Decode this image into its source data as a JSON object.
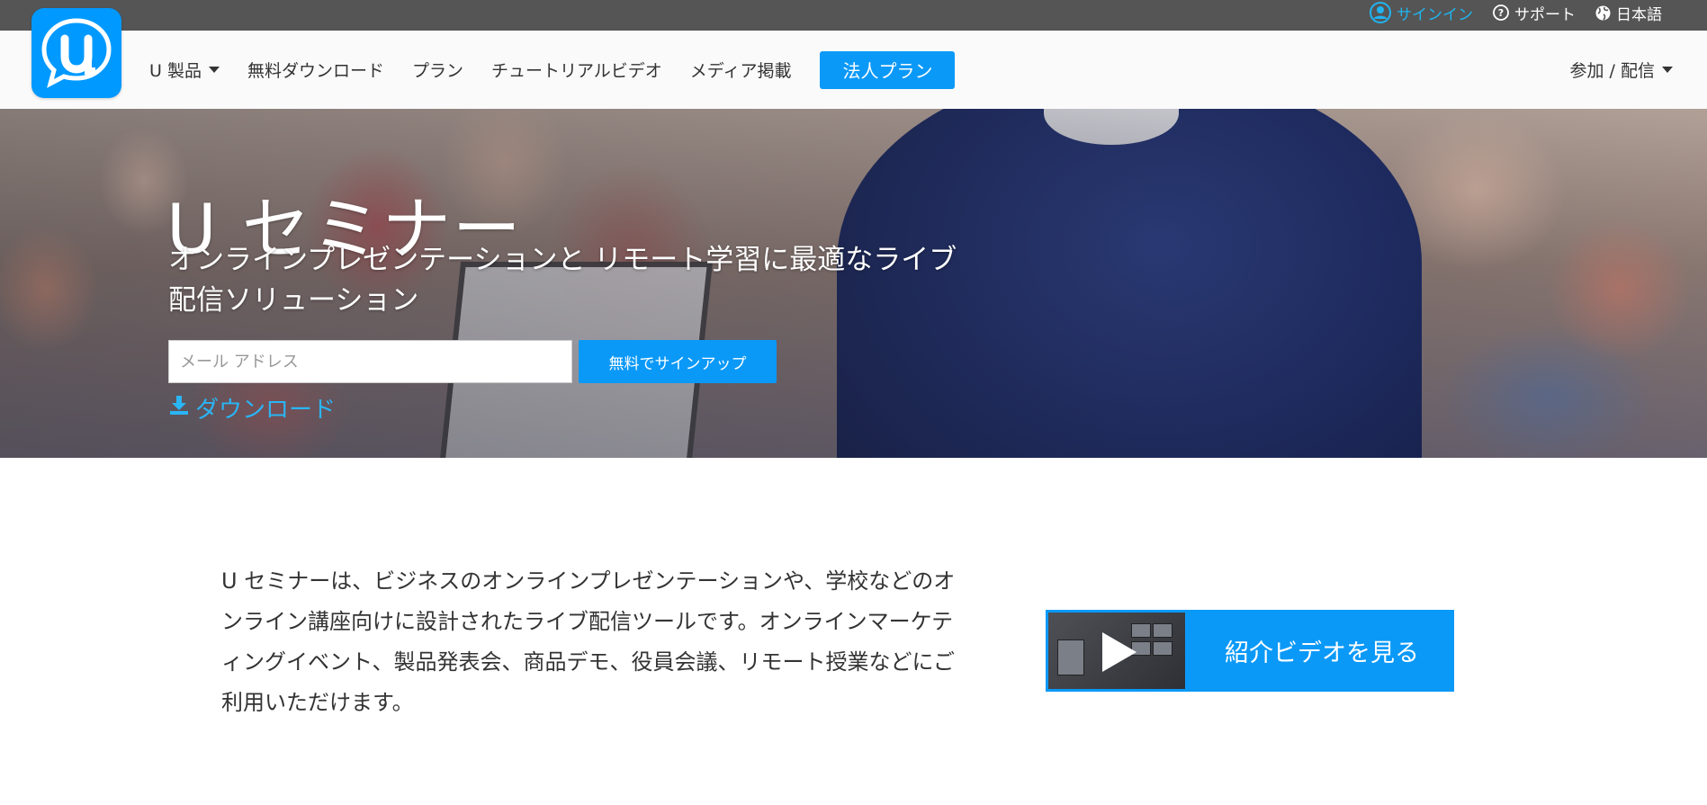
{
  "topbar": {
    "signin": "サインイン",
    "support": "サポート",
    "language": "日本語",
    "icons": [
      "user-circle-icon",
      "question-circle-icon",
      "globe-icon"
    ]
  },
  "nav": {
    "logo_letter": "U",
    "items": [
      "U 製品",
      "無料ダウンロード",
      "プラン",
      "チュートリアルビデオ",
      "メディア掲載"
    ],
    "enterprise": "法人プラン",
    "join": "参加 / 配信"
  },
  "hero": {
    "title": "U セミナー",
    "subtitle": "オンラインプレゼンテーションと リモート学習に最適なライブ配信ソリューション",
    "email_placeholder": "メール アドレス",
    "signup": "無料でサインアップ",
    "download": "ダウンロード"
  },
  "intro": {
    "text": "U セミナーは、ビジネスのオンラインプレゼンテーションや、学校などのオンライン講座向けに設計されたライブ配信ツールです。オンラインマーケティングイベント、製品発表会、商品デモ、役員会議、リモート授業などにご利用いただけます。",
    "video_button": "紹介ビデオを見る"
  },
  "colors": {
    "brand_blue": "#0b99f8",
    "link_cyan": "#2ab5f5",
    "topbar_gray": "#555555"
  }
}
